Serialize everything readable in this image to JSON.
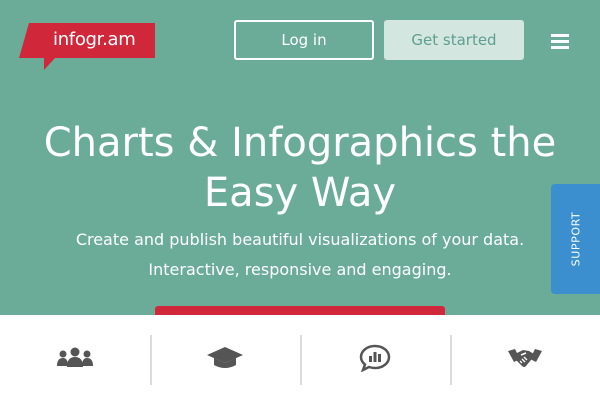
{
  "header": {
    "logo_text": "infogr.am",
    "login_label": "Log in",
    "get_started_label": "Get started",
    "menu_icon": "hamburger-menu-icon"
  },
  "hero": {
    "headline_line1": "Charts & Infographics the",
    "headline_line2": "Easy Way",
    "subtitle_line1": "Create and publish beautiful visualizations of your data.",
    "subtitle_line2": "Interactive, responsive and engaging."
  },
  "support_tab": {
    "label": "SUPPORT"
  },
  "features": [
    {
      "icon": "users-group-icon"
    },
    {
      "icon": "graduation-cap-icon"
    },
    {
      "icon": "chart-bubble-icon"
    },
    {
      "icon": "handshake-icon"
    }
  ],
  "colors": {
    "hero_background": "#6aac98",
    "brand_red": "#d0283a",
    "support_blue": "#3b8fcf",
    "get_started_bg": "#d3e6df",
    "icon_gray": "#555555"
  }
}
